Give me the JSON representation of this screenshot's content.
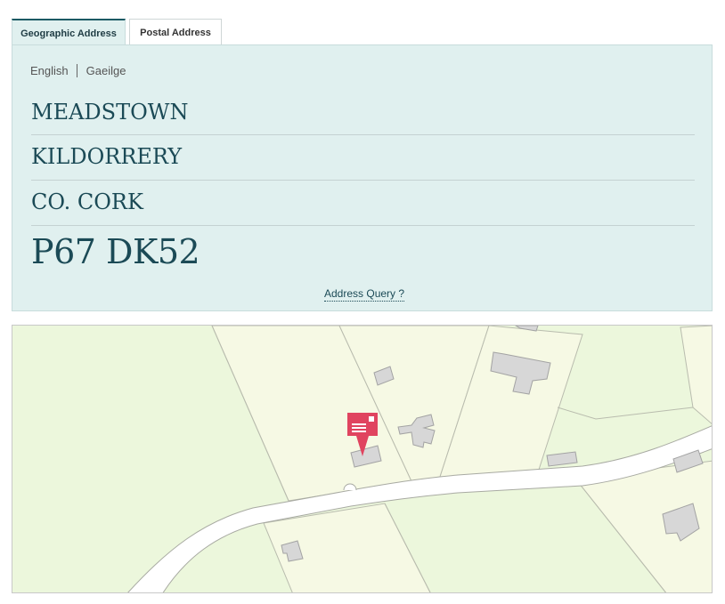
{
  "tabs": {
    "geographic_label": "Geographic Address",
    "postal_label": "Postal Address",
    "active": "geographic"
  },
  "language": {
    "english": "English",
    "irish": "Gaeilge"
  },
  "address": {
    "line1": "MEADSTOWN",
    "line2": "KILDORRERY",
    "line3": "CO. CORK",
    "eircode": "P67 DK52"
  },
  "query_link": "Address Query ?",
  "colors": {
    "panel_bg": "#e0f0ef",
    "address_text": "#1b4a56",
    "marker": "#e0445f",
    "field_light": "#f6f9e4",
    "field_green": "#eaf7d8"
  },
  "map": {
    "marker_icon": "envelope-pin-icon"
  }
}
